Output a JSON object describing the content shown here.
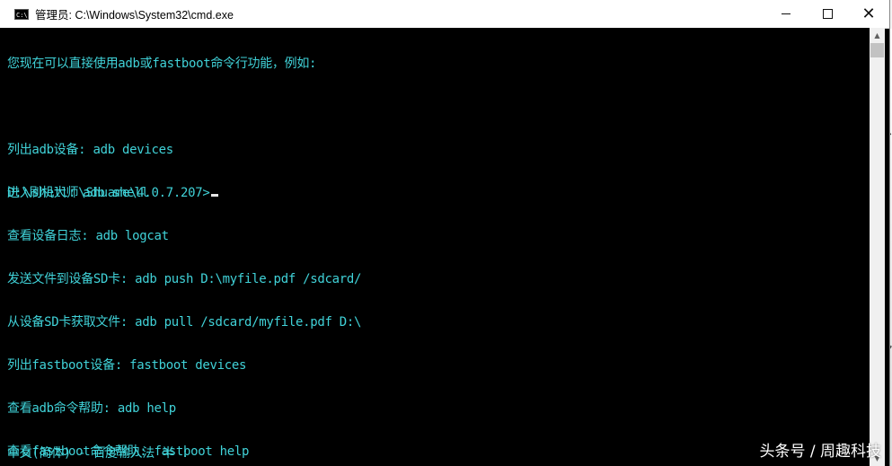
{
  "window": {
    "title": "管理员: C:\\Windows\\System32\\cmd.exe",
    "icon_label": "C:\\",
    "controls": {
      "minimize": "minimize-icon",
      "maximize": "maximize-icon",
      "close": "close-icon"
    }
  },
  "console": {
    "lines": [
      "您现在可以直接使用adb或fastboot命令行功能，例如:",
      "",
      "列出adb设备: adb devices",
      "进入shell: adb shell",
      "查看设备日志: adb logcat",
      "发送文件到设备SD卡: adb push D:\\myfile.pdf /sdcard/",
      "从设备SD卡获取文件: adb pull /sdcard/myfile.pdf D:\\",
      "列出fastboot设备: fastboot devices",
      "查看adb命令帮助: adb help",
      "查看fastboot命令帮助: fastboot help"
    ],
    "prompt": "D:\\刷机大师\\Shuame\\4.0.7.207>",
    "text_color": "#40d2d8",
    "background": "#000000"
  },
  "ime_status": "中文(简体) - 百度输入法 半 :",
  "watermark": "头条号 / 周趣科技"
}
